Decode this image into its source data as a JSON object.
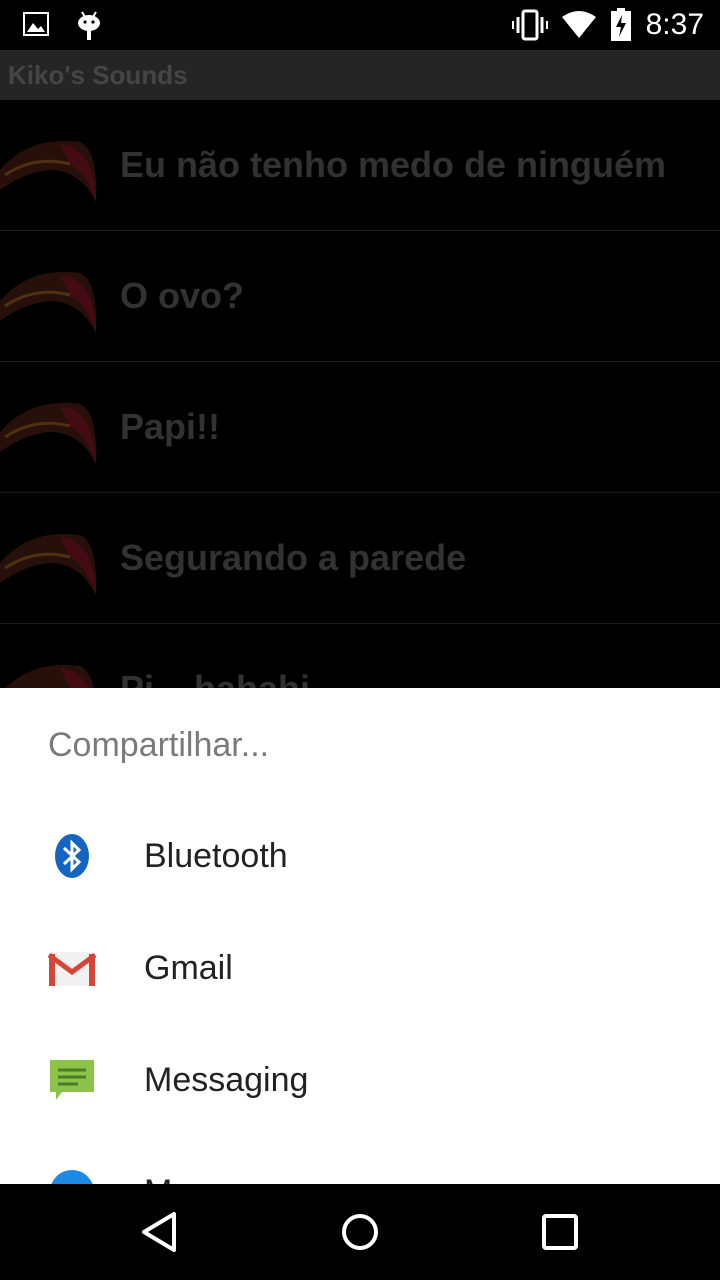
{
  "status_bar": {
    "time": "8:37",
    "left_icons": [
      "image-notification-icon",
      "android-notification-icon"
    ],
    "right_icons": [
      "vibrate-icon",
      "wifi-icon",
      "battery-charging-icon"
    ]
  },
  "app": {
    "title": "Kiko's Sounds"
  },
  "list": {
    "items": [
      {
        "label": "Eu não tenho medo de ninguém"
      },
      {
        "label": "O ovo?"
      },
      {
        "label": "Papi!!"
      },
      {
        "label": "Segurando a parede"
      },
      {
        "label": "Pi... hahahi"
      }
    ]
  },
  "share_sheet": {
    "title": "Compartilhar...",
    "items": [
      {
        "name": "Bluetooth",
        "icon": "bluetooth-icon"
      },
      {
        "name": "Gmail",
        "icon": "gmail-icon"
      },
      {
        "name": "Messaging",
        "icon": "messaging-icon"
      },
      {
        "name": "M...",
        "icon": "messenger-icon"
      }
    ]
  },
  "nav_bar": {
    "icons": [
      "back-icon",
      "home-icon",
      "recents-icon"
    ]
  },
  "colors": {
    "sheet_bg": "#ffffff",
    "status_bg": "#000000",
    "gmail_red": "#d44638",
    "messaging_green": "#8bc34a",
    "bluetooth_blue": "#1565c0"
  }
}
